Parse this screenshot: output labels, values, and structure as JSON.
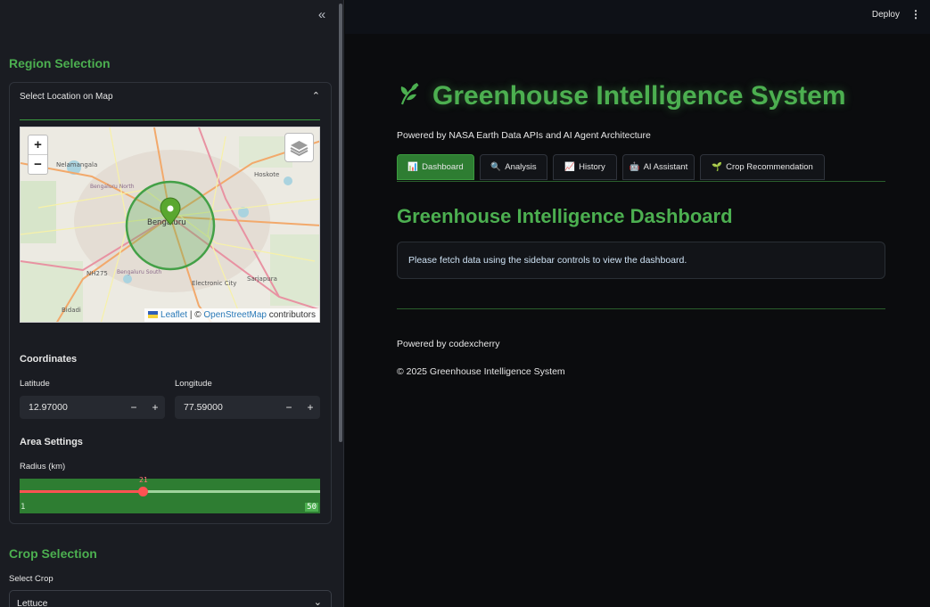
{
  "sidebar": {
    "collapse_icon": "double-chevron-left-icon",
    "region_title": "Region Selection",
    "map_expander": {
      "label": "Select Location on Map",
      "map": {
        "zoom_in": "+",
        "zoom_out": "−",
        "attribution_leaflet": "Leaflet",
        "attribution_sep": "| ©",
        "attribution_osm": "OpenStreetMap",
        "attribution_tail": "contributors",
        "place_labels": [
          "Nelamangala",
          "Bengaluru",
          "Hoskote",
          "NH275",
          "Electronic City",
          "Sarjapura",
          "Bidadi",
          "Bengaluru North",
          "Bengaluru South"
        ]
      }
    },
    "coordinates_title": "Coordinates",
    "latitude_label": "Latitude",
    "latitude_value": "12.97000",
    "longitude_label": "Longitude",
    "longitude_value": "77.59000",
    "minus": "−",
    "plus": "+",
    "area_title": "Area Settings",
    "radius_label": "Radius (km)",
    "radius_value": "21",
    "radius_min": "1",
    "radius_max": "50",
    "crop_title": "Crop Selection",
    "crop_label": "Select Crop",
    "crop_value": "Lettuce"
  },
  "topbar": {
    "deploy": "Deploy",
    "menu": "⋮"
  },
  "main": {
    "title": "Greenhouse Intelligence System",
    "subtitle": "Powered by NASA Earth Data APIs and AI Agent Architecture",
    "tabs": [
      {
        "icon": "📊",
        "label": "Dashboard"
      },
      {
        "icon": "🔍",
        "label": "Analysis"
      },
      {
        "icon": "📈",
        "label": "History"
      },
      {
        "icon": "🤖",
        "label": "AI Assistant"
      },
      {
        "icon": "🌱",
        "label": "Crop Recommendation"
      }
    ],
    "dashboard_title": "Greenhouse Intelligence Dashboard",
    "info_message": "Please fetch data using the sidebar controls to view the dashboard.",
    "footer_powered": "Powered by codexcherry",
    "footer_copyright": "© 2025 Greenhouse Intelligence System"
  },
  "colors": {
    "accent": "#4caf50",
    "tab_active": "#2e7d32",
    "slider": "#ff5252"
  }
}
